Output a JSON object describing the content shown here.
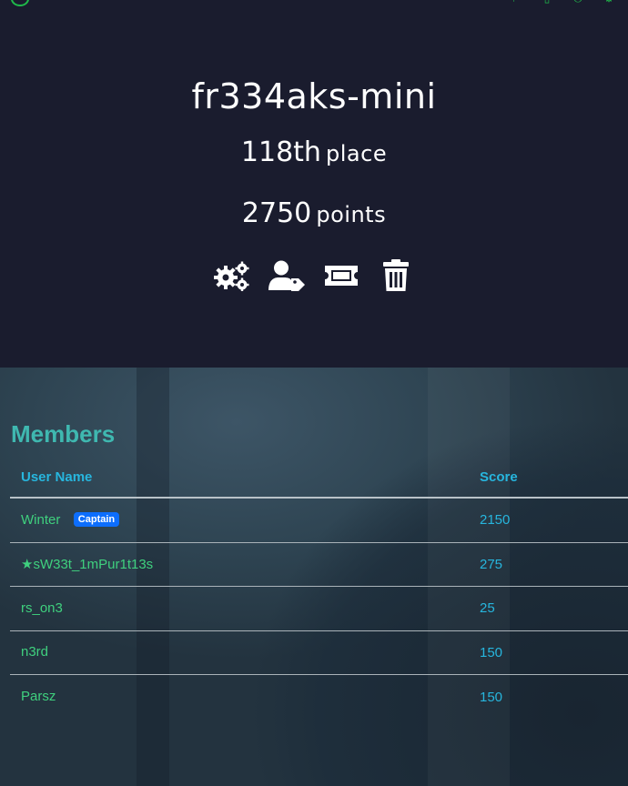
{
  "nav": {
    "brand": "",
    "icons": [
      "user-icon",
      "flag-icon",
      "document-icon",
      "power-icon",
      "settings-icon"
    ]
  },
  "team": {
    "name": "fr334aks-mini",
    "place_number": "118th",
    "place_label": "place",
    "points_number": "2750",
    "points_label": "points"
  },
  "actions": [
    {
      "name": "settings-cogs-icon"
    },
    {
      "name": "user-tag-icon"
    },
    {
      "name": "ticket-icon"
    },
    {
      "name": "trash-icon"
    }
  ],
  "members": {
    "title": "Members",
    "columns": [
      "User Name",
      "Score"
    ],
    "rows": [
      {
        "name": "Winter",
        "badge": "Captain",
        "score": "2150"
      },
      {
        "name": "★sW33t_1mPur1t13s",
        "badge": "",
        "score": "275"
      },
      {
        "name": "rs_on3",
        "badge": "",
        "score": "25"
      },
      {
        "name": "n3rd",
        "badge": "",
        "score": "150"
      },
      {
        "name": "Parsz",
        "badge": "",
        "score": "150"
      }
    ]
  },
  "colors": {
    "hero_bg": "#1a1c2e",
    "accent_teal": "#3fb8b0",
    "link_green": "#3fd07e",
    "score_blue": "#27b6de",
    "badge_blue": "#0d6efd"
  }
}
